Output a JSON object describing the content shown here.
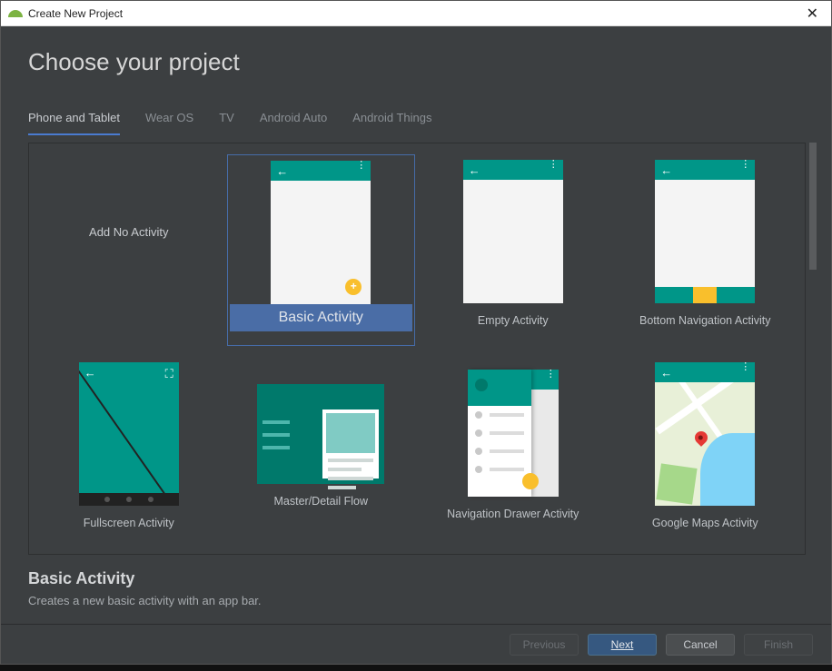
{
  "window": {
    "title": "Create New Project",
    "close_glyph": "✕"
  },
  "header": {
    "title": "Choose your project"
  },
  "tabs": [
    {
      "label": "Phone and Tablet",
      "active": true
    },
    {
      "label": "Wear OS",
      "active": false
    },
    {
      "label": "TV",
      "active": false
    },
    {
      "label": "Android Auto",
      "active": false
    },
    {
      "label": "Android Things",
      "active": false
    }
  ],
  "templates": [
    {
      "label": "Add No Activity",
      "kind": "none",
      "selected": false
    },
    {
      "label": "Basic Activity",
      "kind": "basic",
      "selected": true
    },
    {
      "label": "Empty Activity",
      "kind": "empty",
      "selected": false
    },
    {
      "label": "Bottom Navigation Activity",
      "kind": "bottomnav",
      "selected": false
    },
    {
      "label": "Fullscreen Activity",
      "kind": "fullscreen",
      "selected": false
    },
    {
      "label": "Master/Detail Flow",
      "kind": "masterdetail",
      "selected": false
    },
    {
      "label": "Navigation Drawer Activity",
      "kind": "navdrawer",
      "selected": false
    },
    {
      "label": "Google Maps Activity",
      "kind": "maps",
      "selected": false
    }
  ],
  "description": {
    "title": "Basic Activity",
    "text": "Creates a new basic activity with an app bar."
  },
  "buttons": {
    "previous": "Previous",
    "next": "Next",
    "cancel": "Cancel",
    "finish": "Finish"
  },
  "glyphs": {
    "back_arrow": "←",
    "dot": "⋮",
    "expand": "⛶"
  },
  "colors": {
    "teal": "#009688",
    "accent": "#f9bf2c",
    "selection": "#4a6da6"
  }
}
